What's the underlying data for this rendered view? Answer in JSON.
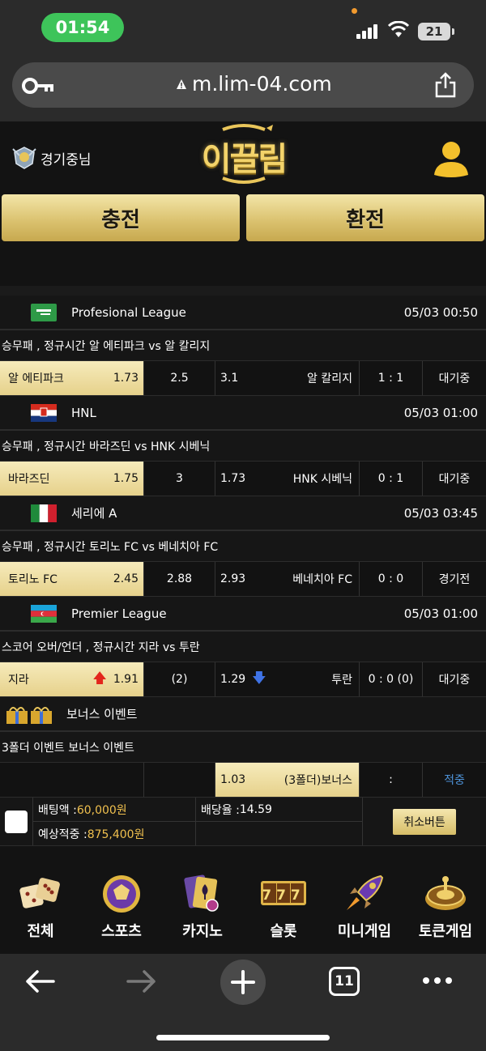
{
  "status_bar": {
    "time": "01:54",
    "battery": "21"
  },
  "browser": {
    "url": "m.lim-04.com"
  },
  "header": {
    "user_status": "경기중님",
    "logo": "이끌림",
    "charge_button": "충전",
    "exchange_button": "환전"
  },
  "bets": [
    {
      "league": "Profesional League",
      "time": "05/03 00:50",
      "title": "승무패 , 정규시간 알 에티파크 vs 알 칼리지",
      "home": "알 에티파크",
      "home_odds": "1.73",
      "draw": "2.5",
      "away_odds": "3.1",
      "away": "알 칼리지",
      "score": "1 : 1",
      "state": "대기중"
    },
    {
      "league": "HNL",
      "time": "05/03 01:00",
      "title": "승무패 , 정규시간 바라즈딘 vs HNK 시베닉",
      "home": "바라즈딘",
      "home_odds": "1.75",
      "draw": "3",
      "away_odds": "1.73",
      "away": "HNK 시베닉",
      "score": "0 : 1",
      "state": "대기중"
    },
    {
      "league": "세리에 A",
      "time": "05/03 03:45",
      "title": "승무패 , 정규시간 토리노 FC vs 베네치아 FC",
      "home": "토리노 FC",
      "home_odds": "2.45",
      "draw": "2.88",
      "away_odds": "2.93",
      "away": "베네치아 FC",
      "score": "0 : 0",
      "state": "경기전"
    },
    {
      "league": "Premier League",
      "time": "05/03 01:00",
      "title": "스코어 오버/언더 , 정규시간 지라 vs 투란",
      "home": "지라",
      "home_odds": "1.91",
      "draw": "(2)",
      "away_odds": "1.29",
      "away": "투란",
      "score": "0 : 0 (0)",
      "state": "대기중"
    }
  ],
  "bonus": {
    "league": "보너스 이벤트",
    "title": "3폴더 이벤트 보너스 이벤트",
    "odds": "1.03",
    "label": "(3폴더)보너스",
    "score": ":",
    "state": "적중"
  },
  "slip": {
    "bet_amount_label": "배팅액 : ",
    "bet_amount": "60,000원",
    "rate_label": "배당율 : ",
    "rate": "14.59",
    "expected_label": "예상적중 : ",
    "expected": "875,400원",
    "cancel_button": "취소버튼"
  },
  "categories": [
    "전체",
    "스포츠",
    "카지노",
    "슬롯",
    "미니게임",
    "토큰게임"
  ],
  "slot_reels": "777",
  "toolbar": {
    "tabs_count": "11"
  },
  "colors": {
    "gold": "#e6d18b",
    "accent_blue": "#4e93d9",
    "gold_text": "#f0c04e"
  }
}
